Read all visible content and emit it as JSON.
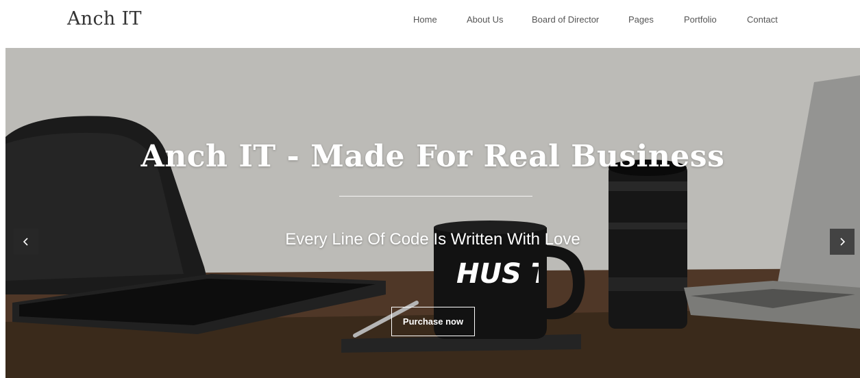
{
  "header": {
    "logo": "Anch IT",
    "nav": [
      {
        "label": "Home"
      },
      {
        "label": "About Us"
      },
      {
        "label": "Board of Director"
      },
      {
        "label": "Pages"
      },
      {
        "label": "Portfolio"
      },
      {
        "label": "Contact"
      }
    ]
  },
  "hero": {
    "title": "Anch IT - Made For Real Business",
    "subtitle": "Every Line Of Code Is Written With Love",
    "cta_label": "Purchase now",
    "mug_text": "HUS TLE",
    "prev_icon": "chevron-left-icon",
    "next_icon": "chevron-right-icon"
  },
  "colors": {
    "text_dark": "#333333",
    "nav_text": "#555555",
    "hero_text": "#ffffff"
  }
}
